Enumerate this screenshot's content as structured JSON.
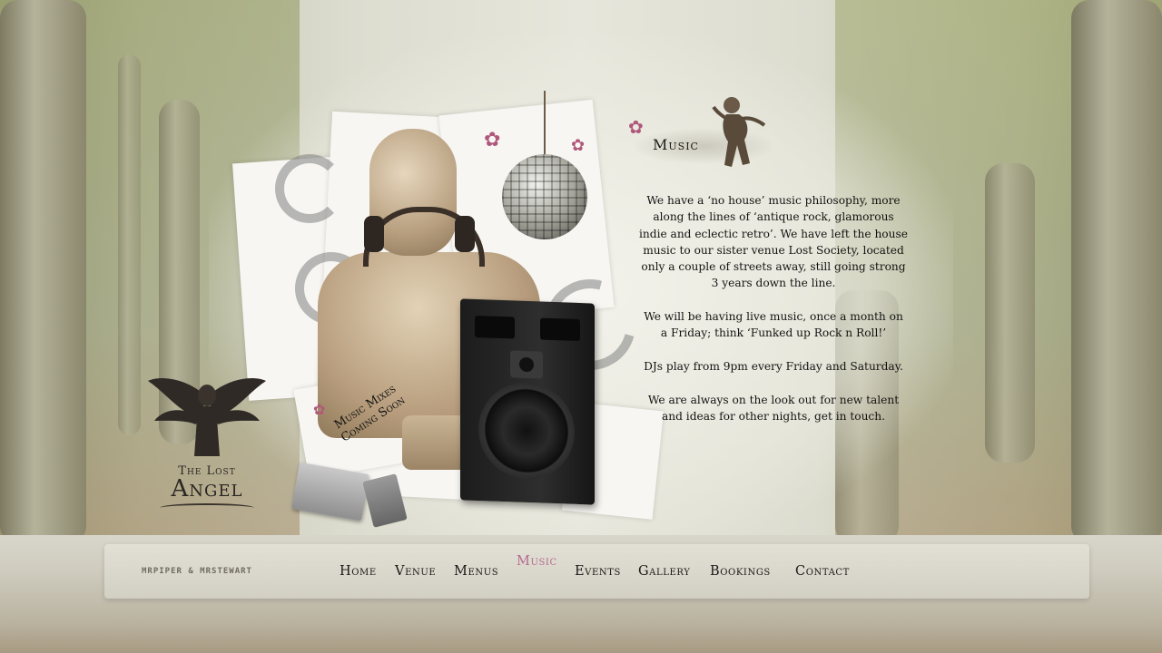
{
  "logo": {
    "line1": "The Lost",
    "line2": "Angel"
  },
  "collage": {
    "mixes_line1": "Music Mixes",
    "mixes_line2": "Coming Soon"
  },
  "page": {
    "heading": "Music",
    "paragraphs": [
      "We have a ‘no house’ music philosophy, more along the lines of ‘antique rock, glamorous indie and eclectic retro’. We have left the house music to our sister venue Lost Society, located only a couple of streets away, still going strong 3 years down the line.",
      "We will be having live music, once a month on a Friday; think ‘Funked up Rock n Roll!’",
      "DJs play from 9pm every Friday and Saturday.",
      "We are always on the look out for new talent and ideas for other nights, get in touch."
    ]
  },
  "footer": {
    "credit": "MRPIPER & MRSTEWART"
  },
  "nav": {
    "items": [
      "Home",
      "Venue",
      "Menus",
      "Music",
      "Events",
      "Gallery",
      "Bookings",
      "Contact"
    ],
    "active": "Music"
  },
  "colors": {
    "accent": "#b36a8e",
    "text": "#141210",
    "flower": "#b0577c"
  },
  "icons": [
    "angel-logo-icon",
    "cherub-icon",
    "flower-icon",
    "disco-ball-icon",
    "speaker-icon",
    "cassette-icon"
  ]
}
